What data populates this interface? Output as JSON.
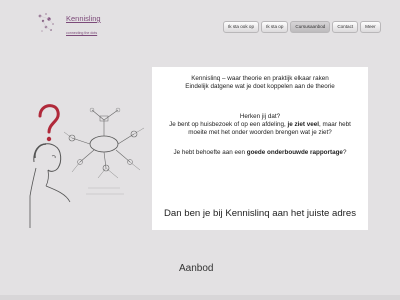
{
  "header": {
    "brand": "Kennisling",
    "tagline": "connecting the dots"
  },
  "nav": [
    {
      "label": "Ik sta ook op"
    },
    {
      "label": "Ik sta op"
    },
    {
      "label": "Cursusaanbod"
    },
    {
      "label": "Contact"
    },
    {
      "label": "Meer"
    }
  ],
  "main": {
    "headline": "Kennislinq – waar theorie en praktijk elkaar raken",
    "subline": "Eindelijk datgene wat je doet koppelen aan de theorie",
    "question": "Herken jij dat?",
    "para1_pre": "Je bent op huisbezoek of op een afdeling, ",
    "para1_bold": "je ziet veel",
    "para1_post": ", maar hebt",
    "para2": "moeite met het onder woorden brengen wat je ziet?",
    "para3_pre": "Je hebt behoefte aan een ",
    "para3_bold": "goede onderbouwde rapportage",
    "para3_post": "?",
    "closing": "Dan ben je bij Kennislinq aan het juiste adres"
  },
  "section": {
    "title": "Aanbod"
  },
  "colors": {
    "accent": "#7c4a79",
    "question_mark": "#b0293a",
    "background": "#e3e1e3"
  },
  "icons": {
    "logo": "dots-logo",
    "illustration": "thinking-person-mindmap"
  }
}
